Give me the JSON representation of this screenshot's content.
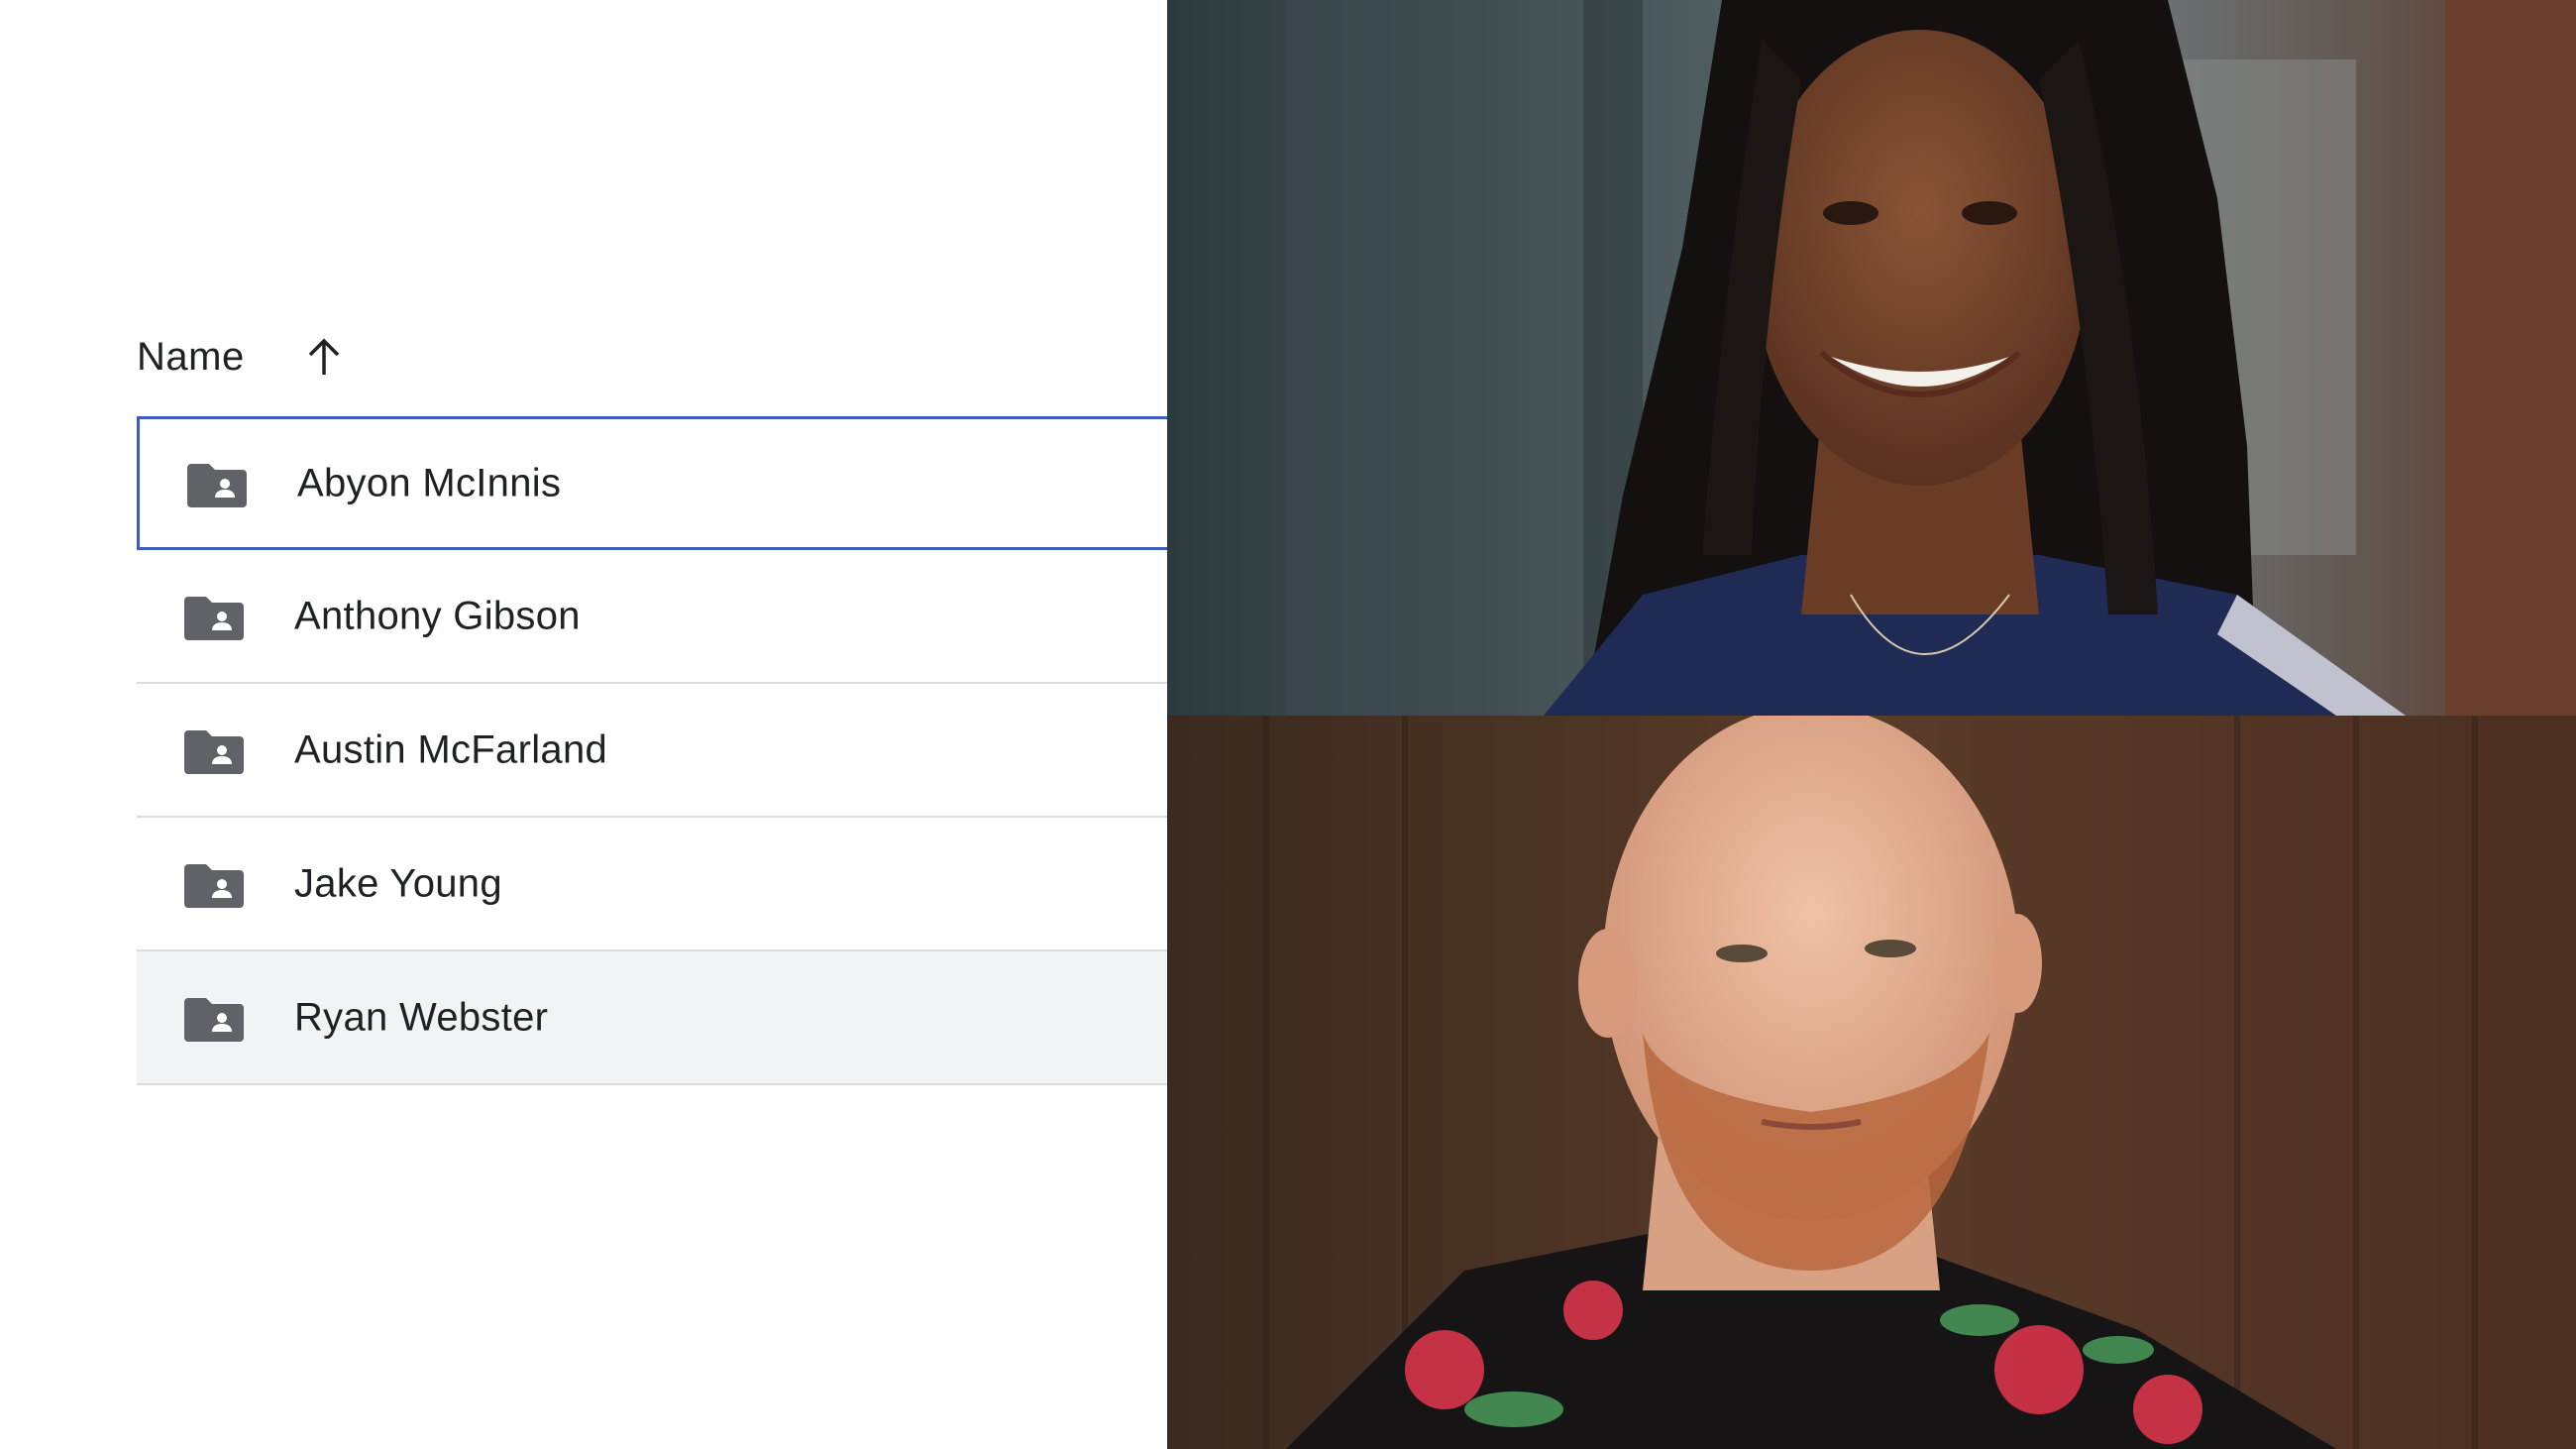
{
  "list": {
    "header_label": "Name",
    "sort_direction": "ascending",
    "sort_icon": "arrow-up-icon",
    "folder_icon": "shared-folder-icon",
    "items": [
      {
        "label": "Abyon McInnis",
        "state": "focused"
      },
      {
        "label": "Anthony Gibson",
        "state": "normal"
      },
      {
        "label": "Austin McFarland",
        "state": "normal"
      },
      {
        "label": "Jake Young",
        "state": "normal"
      },
      {
        "label": "Ryan Webster",
        "state": "hovered"
      }
    ]
  },
  "colors": {
    "text": "#202124",
    "icon": "#5f6368",
    "focus_border": "#3c5dbc",
    "divider": "#dadce0",
    "hover_bg": "#f1f3f4"
  },
  "photos": [
    {
      "subject": "woman-with-braids-smiling"
    },
    {
      "subject": "bald-man-with-beard-floral-shirt"
    }
  ]
}
